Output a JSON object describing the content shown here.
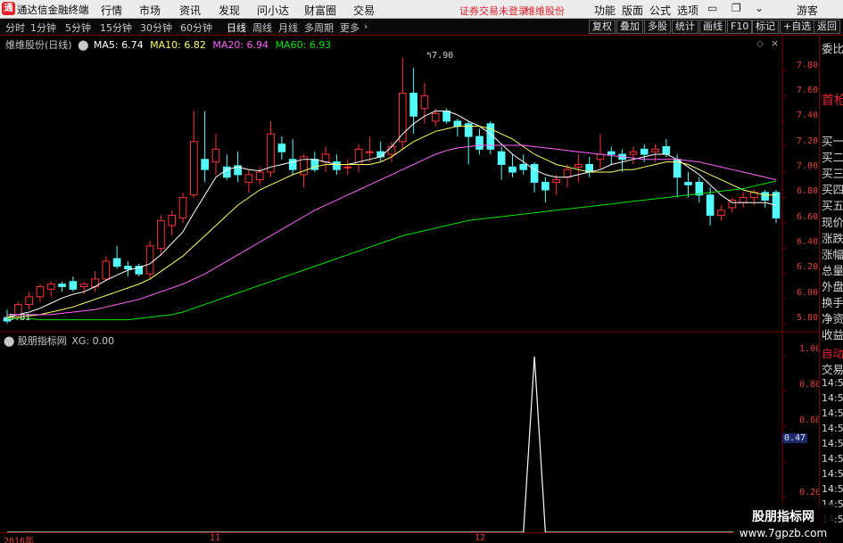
{
  "titlebar": {
    "app_name": "通达信金融终端",
    "menus": [
      "行情",
      "市场",
      "资讯",
      "发现",
      "问小达",
      "财富圈",
      "交易"
    ],
    "warning": "证券交易未登录",
    "stock_name": "维维股份",
    "right_menus": [
      "功能",
      "版面",
      "公式",
      "选项"
    ],
    "guest": "游客"
  },
  "period_toolbar": {
    "periods": [
      "分时",
      "1分钟",
      "5分钟",
      "15分钟",
      "30分钟",
      "60分钟",
      "日线",
      "周线",
      "月线",
      "多周期",
      "更多"
    ],
    "active": "日线",
    "buttons": [
      "复权",
      "叠加",
      "多股",
      "统计",
      "画线",
      "F10",
      "标记",
      "+自选",
      "返回"
    ]
  },
  "main_legend": {
    "title": "维维股份(日线)",
    "ma5": "MA5: 6.74",
    "ma10": "MA10: 6.82",
    "ma20": "MA20: 6.94",
    "ma60": "MA60: 6.93"
  },
  "colors": {
    "up": "#ff3232",
    "down": "#54fcfc",
    "ma5": "#ffffff",
    "ma10": "#ffff64",
    "ma20": "#ff64ff",
    "ma60": "#00e600",
    "indicator": "#ffffff",
    "axis": "#7a0000"
  },
  "price_axis": [
    "7.80",
    "7.60",
    "7.40",
    "7.20",
    "7.00",
    "6.80",
    "6.60",
    "6.40",
    "6.20",
    "6.00",
    "5.80"
  ],
  "annotations": {
    "high": "7.90",
    "low": "5.81"
  },
  "indicator_legend": {
    "title": "股朋指标网",
    "value": "XG: 0.00"
  },
  "indicator_axis": [
    "1.00",
    "0.80",
    "0.60",
    "0.47",
    "0.20"
  ],
  "date_axis": [
    "2016年",
    "11",
    "12"
  ],
  "right_panel": {
    "top": "委比",
    "top2": "首枪",
    "items": [
      "买一",
      "买二",
      "买三",
      "买四",
      "买五",
      "现价",
      "涨跌",
      "涨幅",
      "总量",
      "外盘",
      "换手",
      "净资",
      "收益"
    ],
    "auto": "自动",
    "trade": "交易",
    "times": [
      "14:56",
      "14:56",
      "14:56",
      "14:56",
      "14:56",
      "14:56",
      "14:56",
      "14:56",
      "14:56",
      "14:56"
    ]
  },
  "watermark": {
    "line1": "股朋指标网",
    "line2": "www.7gpzb.com"
  },
  "chart_data": {
    "type": "candlestick",
    "ylim": [
      5.76,
      7.96
    ],
    "candles": [
      {
        "o": 5.85,
        "h": 5.92,
        "l": 5.81,
        "c": 5.83
      },
      {
        "o": 5.88,
        "h": 5.98,
        "l": 5.85,
        "c": 5.96
      },
      {
        "o": 5.96,
        "h": 6.06,
        "l": 5.92,
        "c": 6.02
      },
      {
        "o": 6.02,
        "h": 6.12,
        "l": 5.98,
        "c": 6.1
      },
      {
        "o": 6.08,
        "h": 6.14,
        "l": 6.02,
        "c": 6.12
      },
      {
        "o": 6.12,
        "h": 6.14,
        "l": 6.06,
        "c": 6.1
      },
      {
        "o": 6.14,
        "h": 6.18,
        "l": 6.06,
        "c": 6.08
      },
      {
        "o": 6.1,
        "h": 6.14,
        "l": 6.04,
        "c": 6.12
      },
      {
        "o": 6.1,
        "h": 6.22,
        "l": 6.06,
        "c": 6.16
      },
      {
        "o": 6.16,
        "h": 6.34,
        "l": 6.14,
        "c": 6.3
      },
      {
        "o": 6.32,
        "h": 6.42,
        "l": 6.24,
        "c": 6.26
      },
      {
        "o": 6.26,
        "h": 6.3,
        "l": 6.18,
        "c": 6.24
      },
      {
        "o": 6.26,
        "h": 6.28,
        "l": 6.18,
        "c": 6.2
      },
      {
        "o": 6.2,
        "h": 6.46,
        "l": 6.16,
        "c": 6.42
      },
      {
        "o": 6.4,
        "h": 6.66,
        "l": 6.34,
        "c": 6.62
      },
      {
        "o": 6.58,
        "h": 6.7,
        "l": 6.5,
        "c": 6.66
      },
      {
        "o": 6.64,
        "h": 6.84,
        "l": 6.6,
        "c": 6.8
      },
      {
        "o": 6.82,
        "h": 7.48,
        "l": 6.8,
        "c": 7.24
      },
      {
        "o": 7.1,
        "h": 7.48,
        "l": 6.92,
        "c": 7.02
      },
      {
        "o": 7.08,
        "h": 7.3,
        "l": 6.98,
        "c": 7.18
      },
      {
        "o": 7.04,
        "h": 7.14,
        "l": 6.94,
        "c": 6.96
      },
      {
        "o": 7.05,
        "h": 7.16,
        "l": 6.92,
        "c": 6.98
      },
      {
        "o": 6.92,
        "h": 7.02,
        "l": 6.84,
        "c": 6.98
      },
      {
        "o": 6.94,
        "h": 7.04,
        "l": 6.9,
        "c": 7.0
      },
      {
        "o": 7.0,
        "h": 7.4,
        "l": 6.96,
        "c": 7.3
      },
      {
        "o": 7.22,
        "h": 7.28,
        "l": 7.1,
        "c": 7.16
      },
      {
        "o": 7.1,
        "h": 7.26,
        "l": 6.98,
        "c": 7.02
      },
      {
        "o": 6.98,
        "h": 7.14,
        "l": 6.88,
        "c": 7.12
      },
      {
        "o": 7.1,
        "h": 7.16,
        "l": 7.0,
        "c": 7.02
      },
      {
        "o": 7.08,
        "h": 7.2,
        "l": 7.0,
        "c": 7.14
      },
      {
        "o": 7.08,
        "h": 7.14,
        "l": 6.98,
        "c": 7.02
      },
      {
        "o": 7.04,
        "h": 7.1,
        "l": 6.98,
        "c": 7.04
      },
      {
        "o": 7.06,
        "h": 7.22,
        "l": 7.0,
        "c": 7.18
      },
      {
        "o": 7.16,
        "h": 7.28,
        "l": 7.08,
        "c": 7.16
      },
      {
        "o": 7.16,
        "h": 7.24,
        "l": 7.08,
        "c": 7.12
      },
      {
        "o": 7.14,
        "h": 7.24,
        "l": 7.08,
        "c": 7.2
      },
      {
        "o": 7.24,
        "h": 7.9,
        "l": 7.18,
        "c": 7.62
      },
      {
        "o": 7.62,
        "h": 7.82,
        "l": 7.3,
        "c": 7.44
      },
      {
        "o": 7.5,
        "h": 7.7,
        "l": 7.38,
        "c": 7.6
      },
      {
        "o": 7.4,
        "h": 7.5,
        "l": 7.36,
        "c": 7.46
      },
      {
        "o": 7.48,
        "h": 7.5,
        "l": 7.38,
        "c": 7.4
      },
      {
        "o": 7.4,
        "h": 7.42,
        "l": 7.28,
        "c": 7.36
      },
      {
        "o": 7.38,
        "h": 7.4,
        "l": 7.06,
        "c": 7.28
      },
      {
        "o": 7.28,
        "h": 7.34,
        "l": 7.14,
        "c": 7.18
      },
      {
        "o": 7.38,
        "h": 7.4,
        "l": 7.14,
        "c": 7.18
      },
      {
        "o": 7.16,
        "h": 7.2,
        "l": 6.94,
        "c": 7.06
      },
      {
        "o": 7.04,
        "h": 7.14,
        "l": 6.96,
        "c": 7.0
      },
      {
        "o": 7.06,
        "h": 7.14,
        "l": 6.98,
        "c": 7.02
      },
      {
        "o": 7.06,
        "h": 7.08,
        "l": 6.84,
        "c": 6.92
      },
      {
        "o": 6.92,
        "h": 6.96,
        "l": 6.76,
        "c": 6.86
      },
      {
        "o": 6.92,
        "h": 6.98,
        "l": 6.82,
        "c": 6.94
      },
      {
        "o": 6.96,
        "h": 7.06,
        "l": 6.88,
        "c": 7.02
      },
      {
        "o": 7.04,
        "h": 7.14,
        "l": 6.92,
        "c": 7.06
      },
      {
        "o": 7.06,
        "h": 7.12,
        "l": 6.96,
        "c": 7.0
      },
      {
        "o": 7.1,
        "h": 7.3,
        "l": 7.02,
        "c": 7.14
      },
      {
        "o": 7.16,
        "h": 7.2,
        "l": 7.06,
        "c": 7.14
      },
      {
        "o": 7.14,
        "h": 7.18,
        "l": 7.0,
        "c": 7.1
      },
      {
        "o": 7.14,
        "h": 7.2,
        "l": 7.06,
        "c": 7.16
      },
      {
        "o": 7.18,
        "h": 7.22,
        "l": 7.08,
        "c": 7.14
      },
      {
        "o": 7.16,
        "h": 7.22,
        "l": 7.08,
        "c": 7.18
      },
      {
        "o": 7.2,
        "h": 7.26,
        "l": 7.12,
        "c": 7.14
      },
      {
        "o": 7.1,
        "h": 7.14,
        "l": 6.8,
        "c": 6.96
      },
      {
        "o": 6.92,
        "h": 7.0,
        "l": 6.8,
        "c": 6.9
      },
      {
        "o": 6.92,
        "h": 6.96,
        "l": 6.76,
        "c": 6.82
      },
      {
        "o": 6.82,
        "h": 6.88,
        "l": 6.58,
        "c": 6.66
      },
      {
        "o": 6.66,
        "h": 6.74,
        "l": 6.62,
        "c": 6.7
      },
      {
        "o": 6.72,
        "h": 6.8,
        "l": 6.68,
        "c": 6.78
      },
      {
        "o": 6.76,
        "h": 6.84,
        "l": 6.72,
        "c": 6.8
      },
      {
        "o": 6.8,
        "h": 6.86,
        "l": 6.74,
        "c": 6.84
      },
      {
        "o": 6.84,
        "h": 6.86,
        "l": 6.72,
        "c": 6.78
      },
      {
        "o": 6.84,
        "h": 6.86,
        "l": 6.6,
        "c": 6.64
      }
    ],
    "ma_series": [
      {
        "name": "MA5",
        "color": "#ffffff",
        "values": [
          5.86,
          5.88,
          5.9,
          5.93,
          5.97,
          6.01,
          6.04,
          6.06,
          6.1,
          6.15,
          6.19,
          6.23,
          6.25,
          6.28,
          6.35,
          6.44,
          6.53,
          6.68,
          6.82,
          6.96,
          7.02,
          7.04,
          7.02,
          7.01,
          7.04,
          7.06,
          7.08,
          7.1,
          7.1,
          7.08,
          7.06,
          7.06,
          7.08,
          7.1,
          7.12,
          7.2,
          7.3,
          7.38,
          7.44,
          7.48,
          7.48,
          7.45,
          7.4,
          7.36,
          7.3,
          7.22,
          7.14,
          7.08,
          7.02,
          6.98,
          6.96,
          6.96,
          6.98,
          7.0,
          7.02,
          7.06,
          7.08,
          7.1,
          7.12,
          7.14,
          7.14,
          7.1,
          7.04,
          6.98,
          6.9,
          6.82,
          6.76,
          6.76,
          6.76,
          6.76,
          6.74
        ]
      },
      {
        "name": "MA10",
        "color": "#ffff64",
        "values": [
          5.86,
          5.86,
          5.87,
          5.88,
          5.9,
          5.92,
          5.94,
          5.97,
          6.0,
          6.03,
          6.06,
          6.09,
          6.12,
          6.16,
          6.22,
          6.28,
          6.34,
          6.42,
          6.5,
          6.58,
          6.66,
          6.74,
          6.8,
          6.86,
          6.9,
          6.94,
          6.98,
          7.01,
          7.04,
          7.06,
          7.06,
          7.06,
          7.06,
          7.06,
          7.08,
          7.12,
          7.18,
          7.24,
          7.28,
          7.32,
          7.34,
          7.36,
          7.36,
          7.36,
          7.34,
          7.3,
          7.26,
          7.2,
          7.14,
          7.1,
          7.06,
          7.04,
          7.02,
          7.0,
          7.0,
          7.0,
          7.02,
          7.02,
          7.04,
          7.06,
          7.08,
          7.08,
          7.06,
          7.02,
          6.98,
          6.94,
          6.9,
          6.86,
          6.84,
          6.82,
          6.82
        ]
      },
      {
        "name": "MA20",
        "color": "#ff64ff",
        "values": [
          5.88,
          5.88,
          5.88,
          5.88,
          5.88,
          5.89,
          5.9,
          5.91,
          5.92,
          5.94,
          5.96,
          5.98,
          6.0,
          6.03,
          6.06,
          6.09,
          6.12,
          6.16,
          6.2,
          6.25,
          6.3,
          6.35,
          6.4,
          6.45,
          6.5,
          6.55,
          6.6,
          6.65,
          6.7,
          6.74,
          6.78,
          6.82,
          6.86,
          6.9,
          6.94,
          6.98,
          7.02,
          7.06,
          7.1,
          7.14,
          7.17,
          7.19,
          7.2,
          7.21,
          7.21,
          7.21,
          7.21,
          7.21,
          7.2,
          7.19,
          7.18,
          7.17,
          7.16,
          7.15,
          7.14,
          7.13,
          7.12,
          7.11,
          7.1,
          7.1,
          7.1,
          7.1,
          7.09,
          7.08,
          7.06,
          7.04,
          7.02,
          7.0,
          6.98,
          6.96,
          6.94
        ]
      },
      {
        "name": "MA60",
        "color": "#00e600",
        "values": [
          5.85,
          5.85,
          5.85,
          5.84,
          5.84,
          5.84,
          5.84,
          5.84,
          5.84,
          5.84,
          5.84,
          5.84,
          5.85,
          5.86,
          5.87,
          5.88,
          5.9,
          5.93,
          5.96,
          5.99,
          6.02,
          6.05,
          6.08,
          6.11,
          6.14,
          6.17,
          6.2,
          6.23,
          6.26,
          6.29,
          6.32,
          6.35,
          6.38,
          6.41,
          6.44,
          6.47,
          6.5,
          6.52,
          6.54,
          6.56,
          6.58,
          6.6,
          6.62,
          6.63,
          6.64,
          6.65,
          6.66,
          6.67,
          6.68,
          6.69,
          6.7,
          6.71,
          6.72,
          6.73,
          6.74,
          6.75,
          6.76,
          6.77,
          6.78,
          6.79,
          6.8,
          6.81,
          6.82,
          6.83,
          6.84,
          6.85,
          6.86,
          6.87,
          6.89,
          6.91,
          6.93
        ]
      }
    ],
    "indicator": {
      "name": "XG",
      "ylim": [
        0,
        1.06
      ],
      "spike_index": 48,
      "spike_value": 1.0,
      "values_other": 0.0
    }
  }
}
